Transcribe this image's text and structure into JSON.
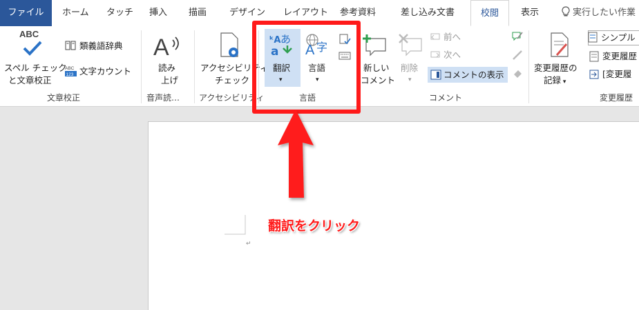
{
  "tabs": [
    "ファイル",
    "ホーム",
    "タッチ",
    "挿入",
    "描画",
    "デザイン",
    "レイアウト",
    "参考資料",
    "差し込み文書",
    "校閲",
    "表示"
  ],
  "tell_me": "実行したい作業",
  "groups": {
    "proofing": {
      "label": "文章校正",
      "spell_line1": "スペル チェック",
      "spell_line2": "と文章校正",
      "thesaurus": "類義語辞典",
      "wordcount": "文字カウント",
      "abc": "ABC"
    },
    "speech": {
      "label": "音声読…",
      "read_line1": "読み",
      "read_line2": "上げ"
    },
    "access": {
      "label": "アクセシビリティ",
      "check_line1": "アクセシビリティ",
      "check_line2": "チェック"
    },
    "language": {
      "label": "言語",
      "translate": "翻訳",
      "language": "言語"
    },
    "comments": {
      "label": "コメント",
      "new_line1": "新しい",
      "new_line2": "コメント",
      "delete": "削除",
      "prev": "前へ",
      "next": "次へ",
      "show": "コメントの表示"
    },
    "tracking": {
      "label": "変更履歴",
      "track_line1": "変更履歴の",
      "track_line2": "記録",
      "simple": "シンプル",
      "changes": "変更履歴",
      "bracket": "[変更履"
    }
  },
  "annotation": {
    "text": "翻訳をクリック",
    "color": "#ff1a1a"
  },
  "colors": {
    "accent": "#2b579a",
    "annotation": "#ff1a1a"
  }
}
